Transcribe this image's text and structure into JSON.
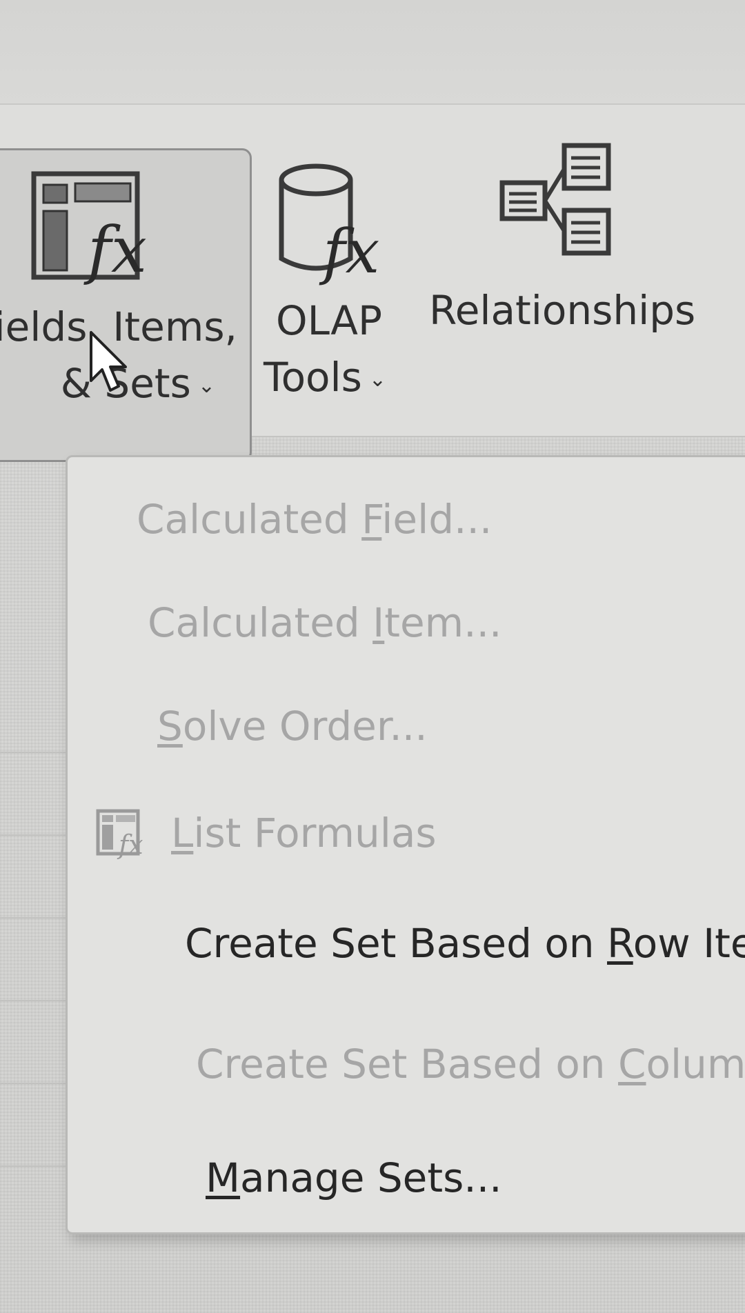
{
  "ribbon": {
    "fields_items_sets": {
      "line1": "ields, Items,",
      "line2": "& Sets",
      "chevron": "chevron-down-icon",
      "icon": "fields-items-sets-icon"
    },
    "olap_tools": {
      "line1": "OLAP",
      "line2": "Tools",
      "chevron": "chevron-down-icon",
      "icon": "olap-cylinder-fx-icon"
    },
    "relationships": {
      "label": "Relationships",
      "icon": "relationships-icon"
    }
  },
  "menu": {
    "items": [
      {
        "pre": "Calculated ",
        "accel": "F",
        "post": "ield...",
        "enabled": false
      },
      {
        "pre": "Calculated ",
        "accel": "I",
        "post": "tem...",
        "enabled": false
      },
      {
        "pre": "",
        "accel": "S",
        "post": "olve Order...",
        "enabled": false
      },
      {
        "pre": "",
        "accel": "L",
        "post": "ist Formulas",
        "enabled": false,
        "icon": "list-formulas-icon"
      },
      {
        "pre": "Create Set Based on ",
        "accel": "R",
        "post": "ow Item",
        "enabled": true
      },
      {
        "pre": "Create Set Based on ",
        "accel": "C",
        "post": "olumn I",
        "enabled": false
      },
      {
        "pre": "",
        "accel": "M",
        "post": "anage Sets...",
        "enabled": true
      }
    ]
  },
  "colors": {
    "enabled_text": "#262626",
    "disabled_text": "#a6a6a6",
    "menu_bg": "#e2e2e0",
    "ribbon_bg": "#dededc"
  }
}
